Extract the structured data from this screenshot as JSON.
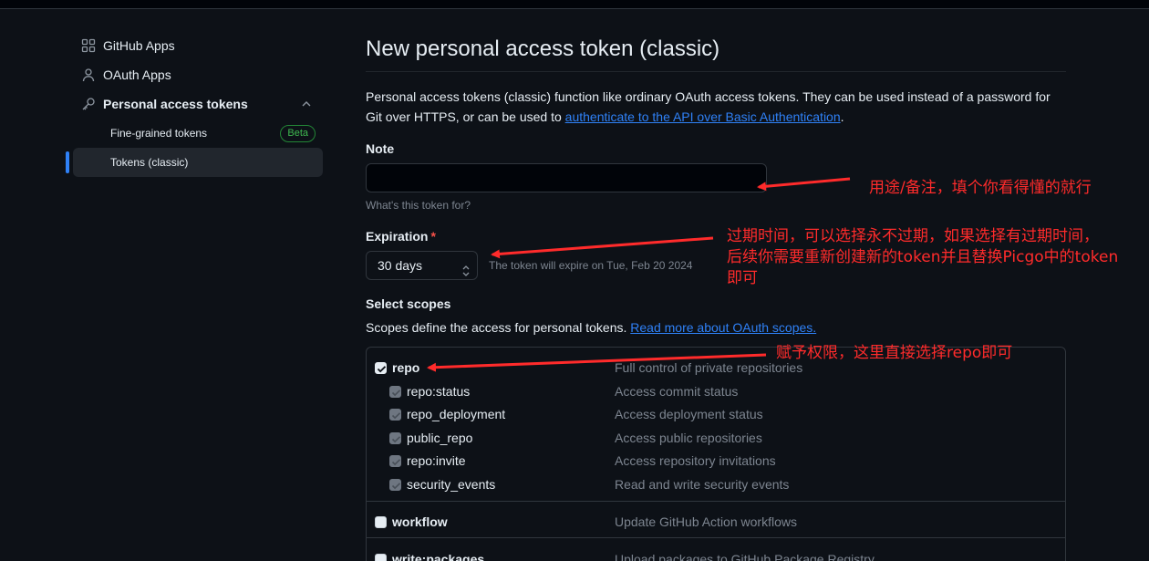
{
  "sidebar": {
    "items": [
      {
        "label": "GitHub Apps",
        "icon": "apps-grid-icon"
      },
      {
        "label": "OAuth Apps",
        "icon": "person-icon"
      },
      {
        "label": "Personal access tokens",
        "icon": "key-icon"
      }
    ],
    "sub_items": [
      {
        "label": "Fine-grained tokens",
        "badge": "Beta"
      },
      {
        "label": "Tokens (classic)"
      }
    ]
  },
  "main": {
    "title": "New personal access token (classic)",
    "description": "Personal access tokens (classic) function like ordinary OAuth access tokens. They can be used instead of a password for Git over HTTPS, or can be used to ",
    "description_link": "authenticate to the API over Basic Authentication",
    "description_end": ".",
    "note": {
      "label": "Note",
      "value": "",
      "hint": "What's this token for?"
    },
    "expiration": {
      "label": "Expiration",
      "required_mark": "*",
      "selected": "30 days",
      "hint": "The token will expire on Tue, Feb 20 2024"
    },
    "scopes": {
      "label": "Select scopes",
      "description": "Scopes define the access for personal tokens. ",
      "link": "Read more about OAuth scopes.",
      "items": [
        {
          "name": "repo",
          "description": "Full control of private repositories",
          "checked": true,
          "level": "top"
        },
        {
          "name": "repo:status",
          "description": "Access commit status",
          "checked": true,
          "level": "sub"
        },
        {
          "name": "repo_deployment",
          "description": "Access deployment status",
          "checked": true,
          "level": "sub"
        },
        {
          "name": "public_repo",
          "description": "Access public repositories",
          "checked": true,
          "level": "sub"
        },
        {
          "name": "repo:invite",
          "description": "Access repository invitations",
          "checked": true,
          "level": "sub"
        },
        {
          "name": "security_events",
          "description": "Read and write security events",
          "checked": true,
          "level": "sub"
        },
        {
          "name": "workflow",
          "description": "Update GitHub Action workflows",
          "checked": false,
          "level": "top"
        },
        {
          "name": "write:packages",
          "description": "Upload packages to GitHub Package Registry",
          "checked": false,
          "level": "top"
        }
      ]
    }
  },
  "annotations": {
    "note": "用途/备注，填个你看得懂的就行",
    "expiration_line1": "过期时间，可以选择永不过期，如果选择有过期时间，",
    "expiration_line2": "后续你需要重新创建新的token并且替换Picgo中的token",
    "expiration_line3": "即可",
    "scopes": "赋予权限，这里直接选择repo即可"
  },
  "colors": {
    "background": "#0d1117",
    "accent": "#2f81f7",
    "annotation": "#ff2b2b",
    "beta": "#3fb950"
  }
}
